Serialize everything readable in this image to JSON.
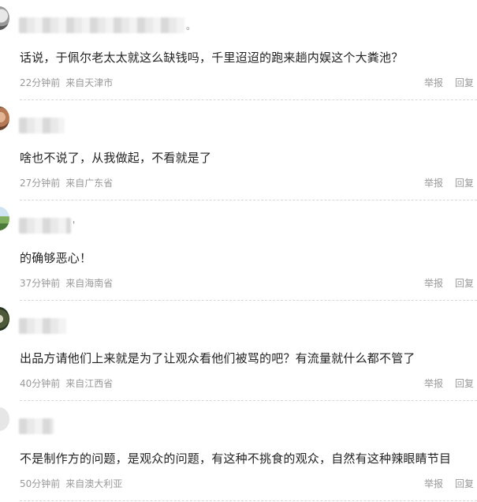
{
  "comments": [
    {
      "text": "话说，于佩尔老太太就这么缺钱吗，千里迢迢的跑来趟内娱这个大粪池？",
      "time": "22分钟前",
      "location": "来自天津市",
      "report_label": "举报",
      "reply_label": "回复"
    },
    {
      "text": "啥也不说了，从我做起，不看就是了",
      "time": "27分钟前",
      "location": "来自广东省",
      "report_label": "举报",
      "reply_label": "回复"
    },
    {
      "text": "的确够恶心！",
      "time": "37分钟前",
      "location": "来自海南省",
      "report_label": "举报",
      "reply_label": "回复"
    },
    {
      "text": "出品方请他们上来就是为了让观众看他们被骂的吧？有流量就什么都不管了",
      "time": "40分钟前",
      "location": "来自江西省",
      "report_label": "举报",
      "reply_label": "回复"
    },
    {
      "text": "不是制作方的问题，是观众的问题，有这种不挑食的观众，自然有这种辣眼睛节目",
      "time": "50分钟前",
      "location": "来自澳大利亚",
      "report_label": "举报",
      "reply_label": "回复"
    }
  ]
}
